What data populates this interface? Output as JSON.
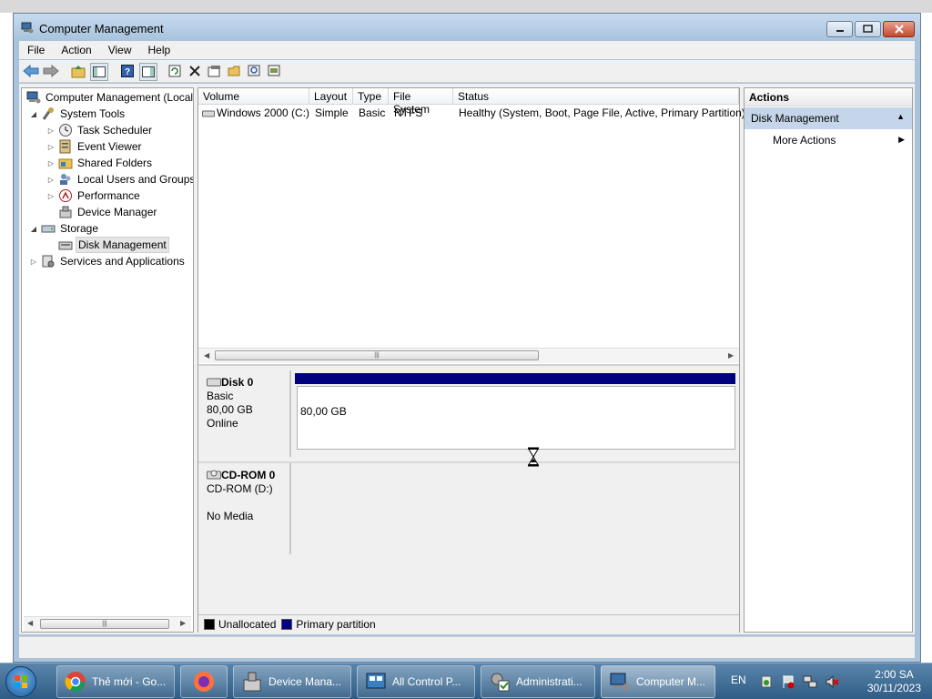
{
  "window": {
    "title": "Computer Management"
  },
  "menu": [
    "File",
    "Action",
    "View",
    "Help"
  ],
  "tree": {
    "root": "Computer Management (Local",
    "nodes": [
      {
        "label": "System Tools",
        "level": 1,
        "expander": "◢",
        "icon": "tools-icon"
      },
      {
        "label": "Task Scheduler",
        "level": 2,
        "expander": "▷",
        "icon": "task-scheduler-icon"
      },
      {
        "label": "Event Viewer",
        "level": 2,
        "expander": "▷",
        "icon": "event-viewer-icon"
      },
      {
        "label": "Shared Folders",
        "level": 2,
        "expander": "▷",
        "icon": "shared-folders-icon"
      },
      {
        "label": "Local Users and Groups",
        "level": 2,
        "expander": "▷",
        "icon": "users-groups-icon"
      },
      {
        "label": "Performance",
        "level": 2,
        "expander": "▷",
        "icon": "performance-icon"
      },
      {
        "label": "Device Manager",
        "level": 2,
        "expander": "",
        "icon": "device-manager-icon"
      },
      {
        "label": "Storage",
        "level": 1,
        "expander": "◢",
        "icon": "storage-icon"
      },
      {
        "label": "Disk Management",
        "level": 2,
        "expander": "",
        "icon": "disk-management-icon",
        "selected": true
      },
      {
        "label": "Services and Applications",
        "level": 1,
        "expander": "▷",
        "icon": "services-icon"
      }
    ]
  },
  "volumes": {
    "columns": [
      "Volume",
      "Layout",
      "Type",
      "File System",
      "Status"
    ],
    "rows": [
      {
        "volume": "Windows 2000 (C:)",
        "layout": "Simple",
        "type": "Basic",
        "fs": "NTFS",
        "status": "Healthy (System, Boot, Page File, Active, Primary Partition)"
      }
    ]
  },
  "disks": [
    {
      "name": "Disk 0",
      "type": "Basic",
      "size": "80,00 GB",
      "state": "Online",
      "partition_size": "80,00 GB"
    },
    {
      "name": "CD-ROM 0",
      "type": "CD-ROM (D:)",
      "size": "",
      "state": "No Media"
    }
  ],
  "legend": [
    {
      "label": "Unallocated",
      "color": "#000000"
    },
    {
      "label": "Primary partition",
      "color": "#000080"
    }
  ],
  "actions": {
    "header": "Actions",
    "section": "Disk Management",
    "item": "More Actions"
  },
  "taskbar": {
    "buttons": [
      {
        "label": "Thẻ mới - Go...",
        "icon": "chrome-icon"
      },
      {
        "label": "",
        "icon": "firefox-icon"
      },
      {
        "label": "Device Mana...",
        "icon": "device-manager-icon"
      },
      {
        "label": "All Control P...",
        "icon": "control-panel-icon"
      },
      {
        "label": "Administrati...",
        "icon": "admin-tools-icon"
      },
      {
        "label": "Computer M...",
        "icon": "computer-management-icon"
      }
    ],
    "lang": "EN",
    "time": "2:00 SA",
    "date": "30/11/2023"
  },
  "colors": {
    "primary_partition": "#000080",
    "actions_section": "#c5d6ea"
  }
}
